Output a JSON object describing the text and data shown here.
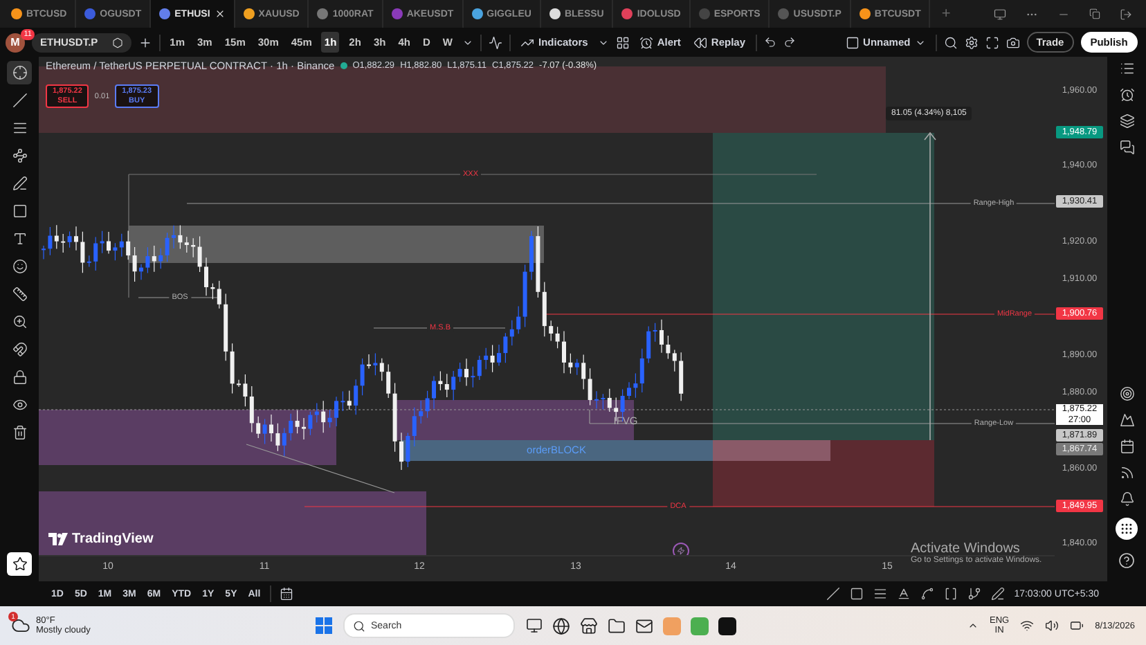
{
  "tabs": [
    {
      "label": "BTCUSD",
      "selected": false,
      "color": "#f7931a"
    },
    {
      "label": "OGUSDT",
      "selected": false,
      "color": "#3b5bdb"
    },
    {
      "label": "ETHUSI",
      "selected": true,
      "color": "#627eea"
    },
    {
      "label": "XAUUSD",
      "selected": false,
      "color": "#f0a020"
    },
    {
      "label": "1000RAT",
      "selected": false,
      "color": "#777777"
    },
    {
      "label": "AKEUSDT",
      "selected": false,
      "color": "#8a3ab9"
    },
    {
      "label": "GIGGLEU",
      "selected": false,
      "color": "#4aa3df"
    },
    {
      "label": "BLESSU",
      "selected": false,
      "color": "#dddddd"
    },
    {
      "label": "IDOLUSD",
      "selected": false,
      "color": "#e0405a"
    },
    {
      "label": "ESPORTS",
      "selected": false,
      "color": "#444444"
    },
    {
      "label": "USUSDT.P",
      "selected": false,
      "color": "#555555"
    },
    {
      "label": "BTCUSDT",
      "selected": false,
      "color": "#f7931a"
    }
  ],
  "new_tab": "+",
  "toolbar": {
    "avatar": "M",
    "badge": "11",
    "symbol": "ETHUSDT.P",
    "intervals": [
      {
        "label": "1m",
        "selected": false
      },
      {
        "label": "3m",
        "selected": false
      },
      {
        "label": "15m",
        "selected": false
      },
      {
        "label": "30m",
        "selected": false
      },
      {
        "label": "45m",
        "selected": false
      },
      {
        "label": "1h",
        "selected": true
      },
      {
        "label": "2h",
        "selected": false
      },
      {
        "label": "3h",
        "selected": false
      },
      {
        "label": "4h",
        "selected": false
      },
      {
        "label": "D",
        "selected": false
      },
      {
        "label": "W",
        "selected": false
      }
    ],
    "indicators": "Indicators",
    "alert": "Alert",
    "replay": "Replay",
    "layout": "Unnamed",
    "trade": "Trade",
    "publish": "Publish"
  },
  "left_tools": [
    {
      "kind": "crosshair",
      "selected": true
    },
    {
      "kind": "trend",
      "selected": false
    },
    {
      "kind": "fib",
      "selected": false
    },
    {
      "kind": "pattern",
      "selected": false
    },
    {
      "kind": "projection",
      "selected": false
    },
    {
      "kind": "shape",
      "selected": false
    },
    {
      "kind": "text",
      "selected": false
    },
    {
      "kind": "emoji",
      "selected": false
    },
    {
      "kind": "ruler",
      "selected": false
    },
    {
      "kind": "zoom",
      "selected": false
    },
    {
      "kind": "magnet",
      "selected": false
    },
    {
      "kind": "lock",
      "selected": false
    },
    {
      "kind": "eye",
      "selected": false
    },
    {
      "kind": "trash",
      "selected": false
    }
  ],
  "legend": {
    "title": "Ethereum / TetherUS PERPETUAL CONTRACT · 1h · Binance",
    "ohlc": [
      {
        "label": "O",
        "value": "1,882.29"
      },
      {
        "label": "H",
        "value": "1,882.80"
      },
      {
        "label": "L",
        "value": "1,875.11"
      },
      {
        "label": "C",
        "value": "1,875.22"
      }
    ],
    "change": "-7.07 (-0.38%)"
  },
  "order": {
    "sell_price": "1,875.22",
    "sell": "SELL",
    "qty": "0.01",
    "buy_price": "1,875.23",
    "buy": "BUY"
  },
  "position_readout": "81.05 (4.34%) 8,105",
  "chart_labels": [
    {
      "text": "XXX",
      "kind": "bearish"
    },
    {
      "text": "Range-High",
      "kind": "neutral"
    },
    {
      "text": "BOS",
      "kind": "neutral"
    },
    {
      "text": "M.S.B",
      "kind": "bearish"
    },
    {
      "text": "MidRange",
      "kind": "bearish"
    },
    {
      "text": "IFVG",
      "kind": "neutral"
    },
    {
      "text": "Range-Low",
      "kind": "neutral"
    },
    {
      "text": "orderBLOCK",
      "kind": "zone"
    },
    {
      "text": "DCA",
      "kind": "bearish"
    }
  ],
  "logo": "TradingView",
  "price_axis": [
    {
      "text": "1,960.00",
      "kind": "tick"
    },
    {
      "text": "1,948.79",
      "kind": "target"
    },
    {
      "text": "1,940.00",
      "kind": "tick"
    },
    {
      "text": "1,930.41",
      "kind": "line"
    },
    {
      "text": "1,920.00",
      "kind": "tick"
    },
    {
      "text": "1,910.00",
      "kind": "tick"
    },
    {
      "text": "1,900.76",
      "kind": "alert"
    },
    {
      "text": "1,890.00",
      "kind": "tick"
    },
    {
      "text": "1,880.00",
      "kind": "tick"
    },
    {
      "text": "1,875.22",
      "countdown": "27:00",
      "kind": "current"
    },
    {
      "text": "1,871.89",
      "kind": "line"
    },
    {
      "text": "1,867.74",
      "kind": "level"
    },
    {
      "text": "1,860.00",
      "kind": "tick"
    },
    {
      "text": "1,849.95",
      "kind": "alert"
    },
    {
      "text": "1,840.00",
      "kind": "tick"
    }
  ],
  "time_axis": [
    "10",
    "11",
    "12",
    "13",
    "14",
    "15"
  ],
  "notice": {
    "title": "Activate Windows",
    "subtitle": "Go to Settings to activate Windows."
  },
  "ranges": [
    {
      "label": "1D",
      "selected": false
    },
    {
      "label": "5D",
      "selected": false
    },
    {
      "label": "1M",
      "selected": false
    },
    {
      "label": "3M",
      "selected": false
    },
    {
      "label": "6M",
      "selected": false
    },
    {
      "label": "YTD",
      "selected": false
    },
    {
      "label": "1Y",
      "selected": false
    },
    {
      "label": "5Y",
      "selected": false
    },
    {
      "label": "All",
      "selected": false
    }
  ],
  "clock": "17:03:00 UTC+5:30",
  "taskbar": {
    "weather_badge": "1",
    "temperature": "80°F",
    "condition": "Mostly cloudy",
    "search": "Search",
    "language": "ENG",
    "region": "IN",
    "date": "8/13/2026"
  }
}
